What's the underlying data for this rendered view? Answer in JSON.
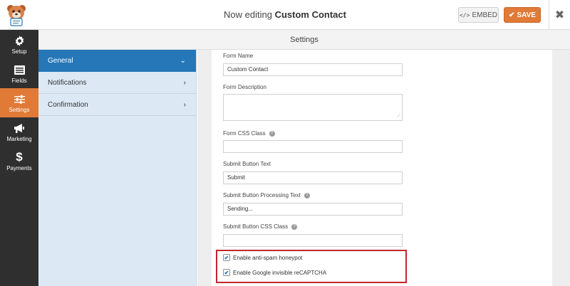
{
  "header": {
    "title_prefix": "Now editing",
    "title_form": "Custom Contact",
    "embed_label": "EMBED",
    "embed_icon": "</>",
    "save_label": "SAVE",
    "save_icon": "✔",
    "close_icon": "✖"
  },
  "sidebar": {
    "items": [
      {
        "label": "Setup",
        "icon": "gear-icon"
      },
      {
        "label": "Fields",
        "icon": "list-icon"
      },
      {
        "label": "Settings",
        "icon": "sliders-icon",
        "active": true
      },
      {
        "label": "Marketing",
        "icon": "megaphone-icon"
      },
      {
        "label": "Payments",
        "icon": "dollar-icon"
      }
    ]
  },
  "settings_header": "Settings",
  "settings_nav": {
    "items": [
      {
        "label": "General",
        "chevron": "⌄"
      },
      {
        "label": "Notifications",
        "chevron": "›"
      },
      {
        "label": "Confirmation",
        "chevron": "›"
      }
    ]
  },
  "form": {
    "form_name": {
      "label": "Form Name",
      "value": "Custom Contact"
    },
    "form_description": {
      "label": "Form Description",
      "value": ""
    },
    "form_css_class": {
      "label": "Form CSS Class",
      "value": ""
    },
    "submit_text": {
      "label": "Submit Button Text",
      "value": "Submit"
    },
    "processing_text": {
      "label": "Submit Button Processing Text",
      "value": "Sending..."
    },
    "submit_css_class": {
      "label": "Submit Button CSS Class",
      "value": ""
    },
    "honeypot": {
      "label": "Enable anti-spam honeypot",
      "checked": true
    },
    "recaptcha": {
      "label": "Enable Google invisible reCAPTCHA",
      "checked": true
    },
    "help_glyph": "?",
    "check_glyph": "✔",
    "resize_glyph": "⟋"
  },
  "colors": {
    "accent": "#e07a36",
    "nav_active": "#2577b8",
    "highlight": "#c2262e",
    "sidebar_bg": "#2f2f2f"
  }
}
